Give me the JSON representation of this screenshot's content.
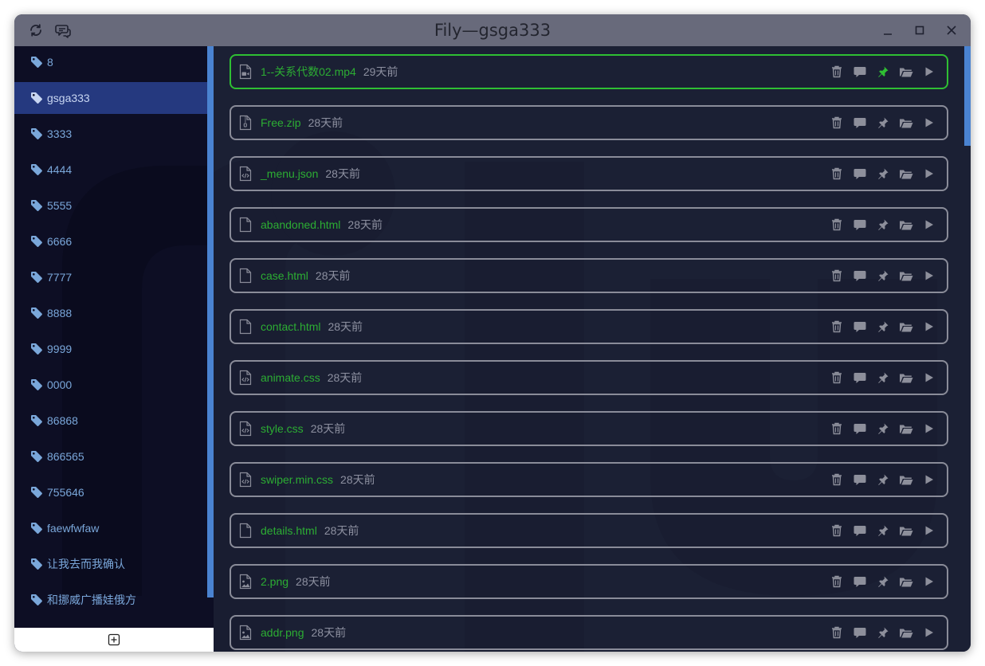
{
  "window": {
    "title": "Fily—gsga333"
  },
  "titlebar": {
    "left_icons": [
      "refresh-icon",
      "chat-icon"
    ],
    "right_icons": [
      "minimize-icon",
      "maximize-icon",
      "close-icon"
    ]
  },
  "sidebar": {
    "active_index": 1,
    "tags": [
      {
        "label": "8"
      },
      {
        "label": "gsga333"
      },
      {
        "label": "3333"
      },
      {
        "label": "4444"
      },
      {
        "label": "5555"
      },
      {
        "label": "6666"
      },
      {
        "label": "7777"
      },
      {
        "label": "8888"
      },
      {
        "label": "9999"
      },
      {
        "label": "0000"
      },
      {
        "label": "86868"
      },
      {
        "label": "866565"
      },
      {
        "label": "755646"
      },
      {
        "label": "faewfwfaw"
      },
      {
        "label": "让我去而我确认"
      },
      {
        "label": "和挪威广播娃俄方"
      }
    ],
    "add_icon": "plus-square-icon"
  },
  "files": [
    {
      "name": "1--关系代数02.mp4",
      "age": "29天前",
      "type": "video",
      "pinned": true,
      "selected": true
    },
    {
      "name": "Free.zip",
      "age": "28天前",
      "type": "zip",
      "pinned": false,
      "selected": false
    },
    {
      "name": "_menu.json",
      "age": "28天前",
      "type": "code",
      "pinned": false,
      "selected": false
    },
    {
      "name": "abandoned.html",
      "age": "28天前",
      "type": "blank",
      "pinned": false,
      "selected": false
    },
    {
      "name": "case.html",
      "age": "28天前",
      "type": "blank",
      "pinned": false,
      "selected": false
    },
    {
      "name": "contact.html",
      "age": "28天前",
      "type": "blank",
      "pinned": false,
      "selected": false
    },
    {
      "name": "animate.css",
      "age": "28天前",
      "type": "code",
      "pinned": false,
      "selected": false
    },
    {
      "name": "style.css",
      "age": "28天前",
      "type": "code",
      "pinned": false,
      "selected": false
    },
    {
      "name": "swiper.min.css",
      "age": "28天前",
      "type": "code",
      "pinned": false,
      "selected": false
    },
    {
      "name": "details.html",
      "age": "28天前",
      "type": "blank",
      "pinned": false,
      "selected": false
    },
    {
      "name": "2.png",
      "age": "28天前",
      "type": "image",
      "pinned": false,
      "selected": false
    },
    {
      "name": "addr.png",
      "age": "28天前",
      "type": "image",
      "pinned": false,
      "selected": false
    }
  ],
  "file_actions": [
    "trash-icon",
    "comment-icon",
    "pin-icon",
    "folder-open-icon",
    "play-icon"
  ],
  "colors": {
    "sidebar_bg": "#0d0e24",
    "active_tag_bg": "#25397f",
    "tag_text": "#7aa7da",
    "main_bg": "#1b2034",
    "file_name": "#2cad33",
    "selected_border": "#2fbf33",
    "scrollbar": "#4a83d1"
  }
}
